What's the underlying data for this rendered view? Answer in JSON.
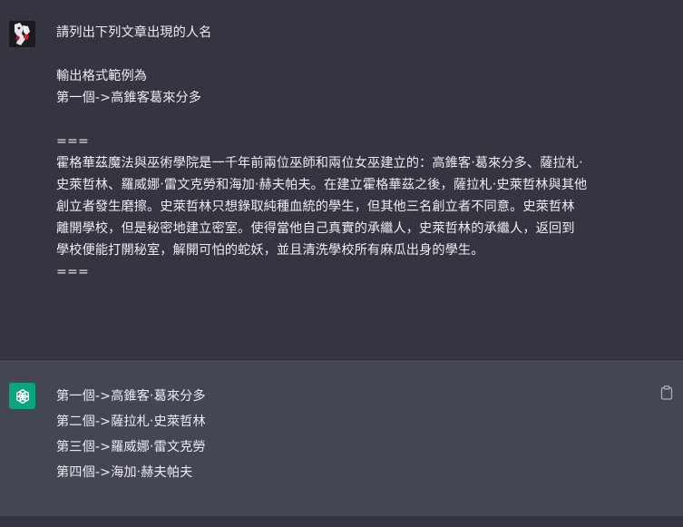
{
  "user_message": {
    "avatar": "user-avatar",
    "lines": [
      "請列出下列文章出現的人名",
      "",
      "輸出格式範例為",
      "第一個->高錐客葛來分多",
      "",
      "===",
      "霍格華茲魔法與巫術學院是一千年前兩位巫師和兩位女巫建立的：高錐客‧葛來分多、薩拉札‧",
      "史萊哲林、羅威娜‧雷文克勞和海加‧赫夫帕夫。在建立霍格華茲之後，薩拉札‧史萊哲林與其他",
      "創立者發生磨擦。史萊哲林只想錄取純種血統的學生，但其他三名創立者不同意。史萊哲林",
      "離開學校，但是秘密地建立密室。使得當他自己真實的承繼人，史萊哲林的承繼人，返回到",
      "學校便能打開秘室，解開可怕的蛇妖，並且清洗學校所有麻瓜出身的學生。",
      "==="
    ]
  },
  "assistant_message": {
    "avatar": "openai-logo-icon",
    "lines": [
      "第一個->高錐客‧葛來分多",
      "第二個->薩拉札‧史萊哲林",
      "第三個->羅威娜‧雷文克勞",
      "第四個->海加‧赫夫帕夫"
    ],
    "copy_icon": "clipboard-icon"
  },
  "colors": {
    "user_bg": "#343541",
    "assistant_bg": "#444654",
    "text": "#ececf1",
    "bot_avatar": "#10a37f"
  }
}
